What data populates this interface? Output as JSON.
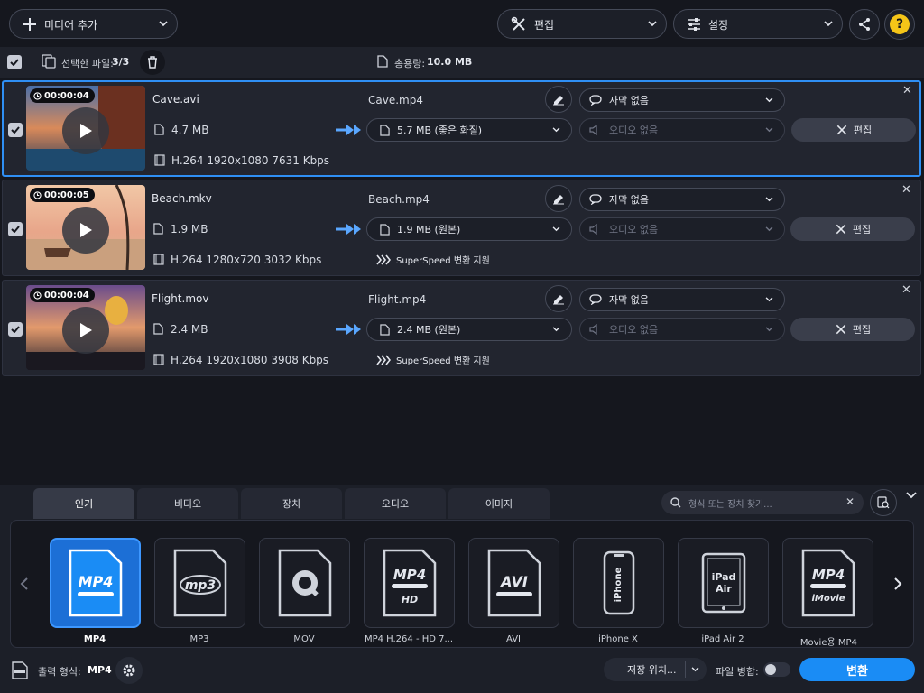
{
  "toolbar": {
    "add_media_label": "미디어 추가",
    "edit_label": "편집",
    "settings_label": "설정"
  },
  "selection": {
    "selected_files_label": "선택한 파일:",
    "selected_files_value": "3/3",
    "total_size_label": "총용량:",
    "total_size_value": "10.0 MB"
  },
  "files": [
    {
      "duration": "00:00:04",
      "source_name": "Cave.avi",
      "source_size": "4.7 MB",
      "source_info": "H.264 1920x1080 7631 Kbps",
      "output_name": "Cave.mp4",
      "output_size": "5.7 MB (좋은 화질)",
      "subtitle": "자막 없음",
      "audio": "오디오 없음",
      "edit_label": "편집",
      "superspeed": ""
    },
    {
      "duration": "00:00:05",
      "source_name": "Beach.mkv",
      "source_size": "1.9 MB",
      "source_info": "H.264 1280x720 3032 Kbps",
      "output_name": "Beach.mp4",
      "output_size": "1.9 MB (원본)",
      "subtitle": "자막 없음",
      "audio": "오디오 없음",
      "edit_label": "편집",
      "superspeed": "SuperSpeed 변환 지원"
    },
    {
      "duration": "00:00:04",
      "source_name": "Flight.mov",
      "source_size": "2.4 MB",
      "source_info": "H.264 1920x1080 3908 Kbps",
      "output_name": "Flight.mp4",
      "output_size": "2.4 MB (원본)",
      "subtitle": "자막 없음",
      "audio": "오디오 없음",
      "edit_label": "편집",
      "superspeed": "SuperSpeed 변환 지원"
    }
  ],
  "format_tabs": [
    "인기",
    "비디오",
    "장치",
    "오디오",
    "이미지"
  ],
  "search": {
    "placeholder": "형식 또는 장치 찾기..."
  },
  "formats": [
    {
      "label": "MP4",
      "badge": "MP4"
    },
    {
      "label": "MP3",
      "badge": "mp3"
    },
    {
      "label": "MOV",
      "badge": ""
    },
    {
      "label": "MP4 H.264 - HD 7...",
      "badge": "MP4"
    },
    {
      "label": "AVI",
      "badge": "AVI"
    },
    {
      "label": "iPhone X",
      "badge": "iPhone"
    },
    {
      "label": "iPad Air 2",
      "badge": "iPad Air"
    },
    {
      "label": "iMovie용 MP4",
      "badge": "MP4"
    }
  ],
  "footer": {
    "output_format_label": "출력 형식:",
    "output_format_value": "MP4",
    "save_location_label": "저장 위치...",
    "merge_files_label": "파일 병합:",
    "convert_label": "변환"
  },
  "colors": {
    "accent": "#1a8cf5",
    "selected_border": "#2f8ff4",
    "help_yellow": "#f5c518"
  }
}
